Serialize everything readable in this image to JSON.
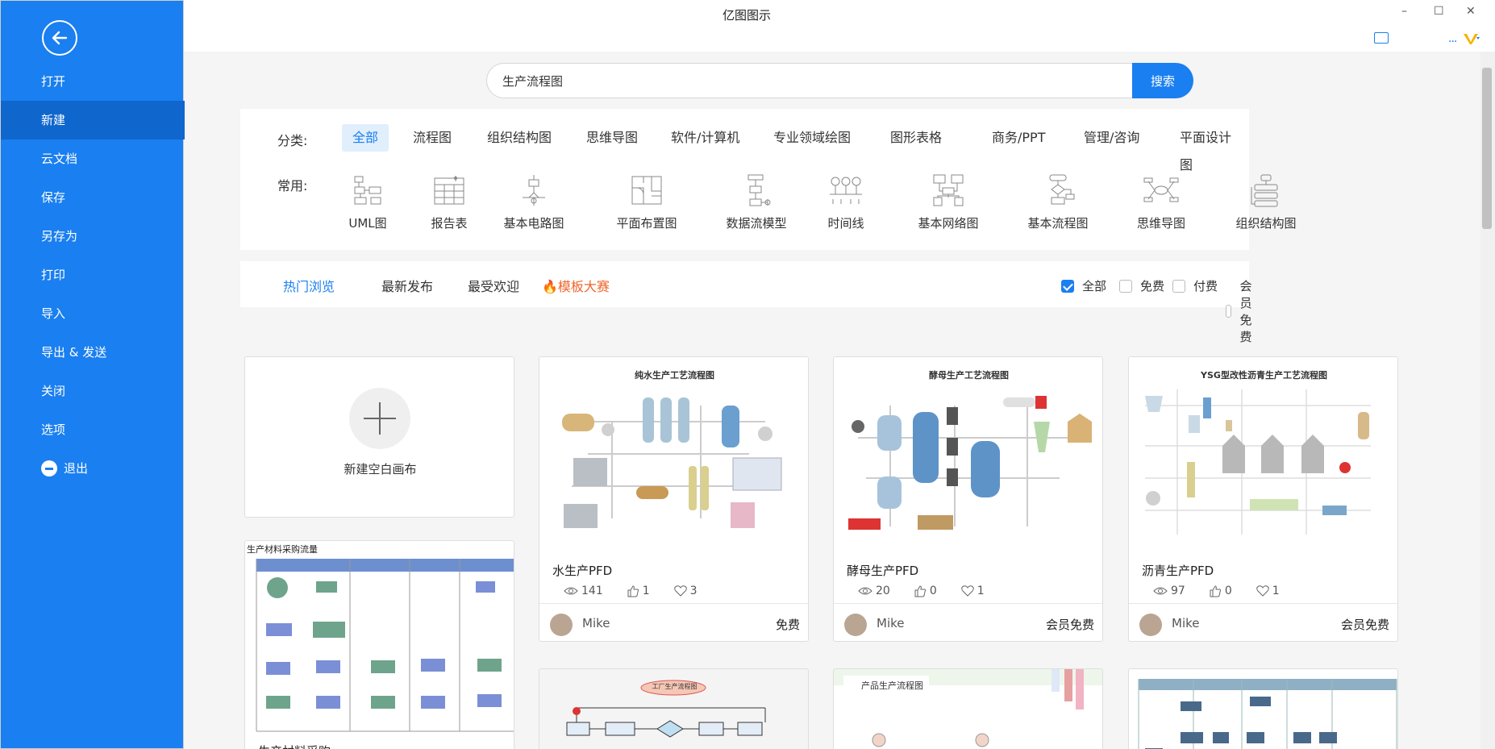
{
  "app": {
    "title": "亿图图示"
  },
  "sidebar": {
    "items": [
      {
        "label": "打开"
      },
      {
        "label": "新建"
      },
      {
        "label": "云文档"
      },
      {
        "label": "保存"
      },
      {
        "label": "另存为"
      },
      {
        "label": "打印"
      },
      {
        "label": "导入"
      },
      {
        "label": "导出 & 发送"
      },
      {
        "label": "关闭"
      },
      {
        "label": "选项"
      },
      {
        "label": "退出"
      }
    ],
    "accent": "#1a7ff0",
    "active_bg": "#0f66cd"
  },
  "window": {
    "minimize": "–",
    "maximize": "☐",
    "close": "✕",
    "more": "..."
  },
  "search": {
    "value": "生产流程图",
    "button": "搜索"
  },
  "categories": {
    "label": "分类:",
    "items": [
      "全部",
      "流程图",
      "组织结构图",
      "思维导图",
      "软件/计算机",
      "专业领域绘图",
      "图形表格",
      "商务/PPT",
      "管理/咨询",
      "平面设计图"
    ]
  },
  "common": {
    "label": "常用:",
    "items": [
      "UML图",
      "报告表",
      "基本电路图",
      "平面布置图",
      "数据流模型",
      "时间线",
      "基本网络图",
      "基本流程图",
      "思维导图",
      "组织结构图"
    ]
  },
  "filters": {
    "tabs": [
      "热门浏览",
      "最新发布",
      "最受欢迎",
      "模板大赛"
    ],
    "checks": [
      {
        "label": "全部",
        "checked": true
      },
      {
        "label": "免费",
        "checked": false
      },
      {
        "label": "付费",
        "checked": false
      },
      {
        "label": "会员免费",
        "checked": false
      }
    ]
  },
  "new_canvas": {
    "label": "新建空白画布"
  },
  "templates": [
    {
      "thumb_title": "纯水生产工艺流程图",
      "name": "水生产PFD",
      "views": "141",
      "likes": "1",
      "favs": "3",
      "author": "Mike",
      "price": "免费"
    },
    {
      "thumb_title": "酵母生产工艺流程图",
      "name": "酵母生产PFD",
      "views": "20",
      "likes": "0",
      "favs": "1",
      "author": "Mike",
      "price": "会员免费"
    },
    {
      "thumb_title": "YSG型改性沥青生产工艺流程图",
      "name": "沥青生产PFD",
      "views": "97",
      "likes": "0",
      "favs": "1",
      "author": "Mike",
      "price": "会员免费"
    }
  ],
  "partial_cards": [
    {
      "thumb_title": "生产材料采购流量",
      "name": "生产材料采购"
    },
    {
      "thumb_title": "工厂生产流程图"
    },
    {
      "thumb_title": "产品生产流程图"
    },
    {
      "thumb_title": ""
    }
  ]
}
